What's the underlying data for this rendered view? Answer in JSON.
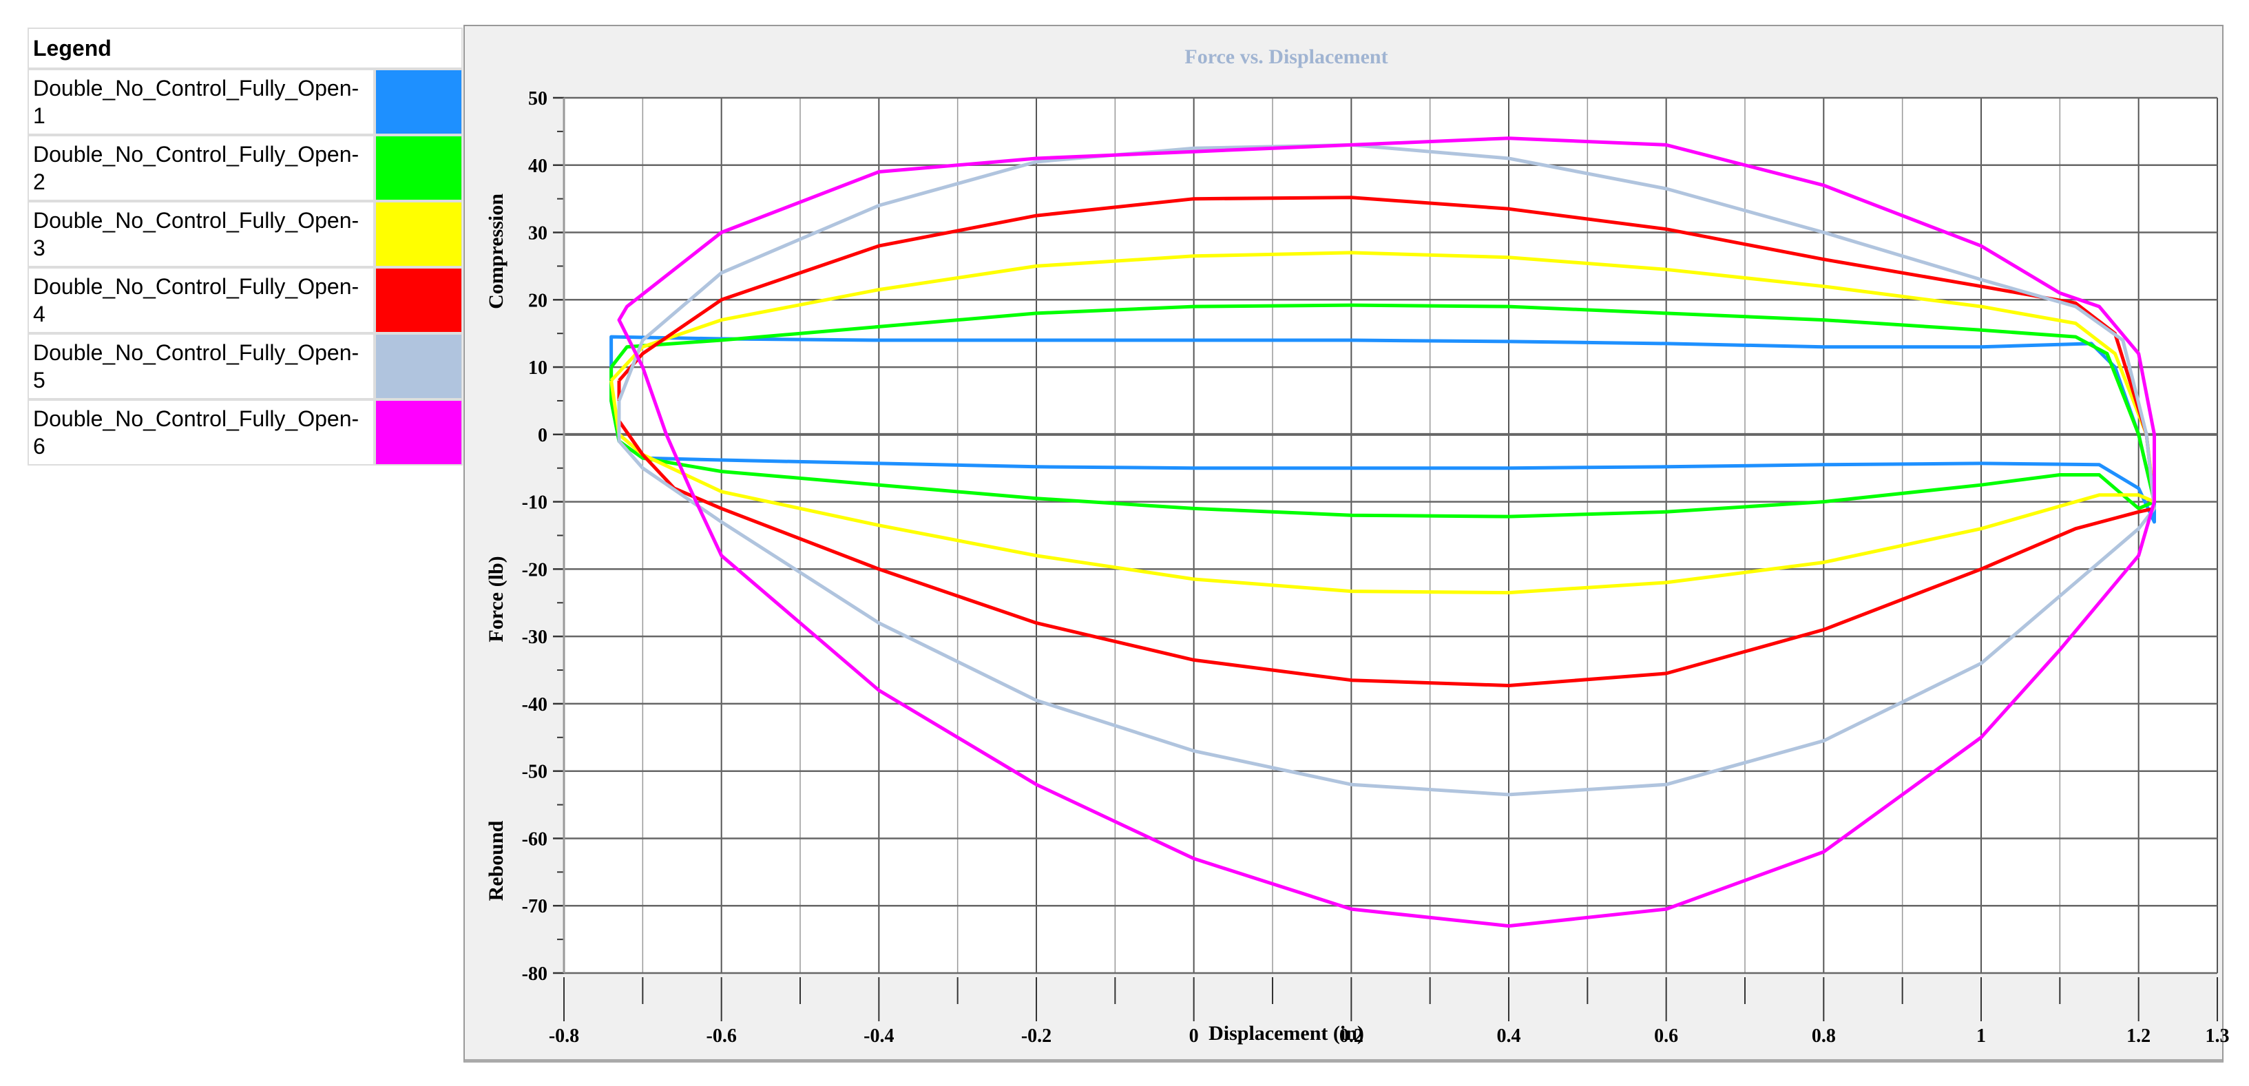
{
  "legend": {
    "title": "Legend",
    "items": [
      {
        "label": "Double_No_Control_Fully_Open-1",
        "color": "#1e90ff"
      },
      {
        "label": "Double_No_Control_Fully_Open-2",
        "color": "#00ff00"
      },
      {
        "label": "Double_No_Control_Fully_Open-3",
        "color": "#ffff00"
      },
      {
        "label": "Double_No_Control_Fully_Open-4",
        "color": "#ff0000"
      },
      {
        "label": "Double_No_Control_Fully_Open-5",
        "color": "#b0c4de"
      },
      {
        "label": "Double_No_Control_Fully_Open-6",
        "color": "#ff00ff"
      }
    ]
  },
  "chart_data": {
    "type": "line",
    "title": "Force vs. Displacement",
    "xlabel": "Displacement (in)",
    "ylabel": "Force (lb)",
    "ylabel_top": "Compression",
    "ylabel_bottom": "Rebound",
    "xlim": [
      -0.8,
      1.3
    ],
    "ylim": [
      -80,
      50
    ],
    "xticks": [
      -0.8,
      -0.6,
      -0.4,
      -0.2,
      0,
      0.2,
      0.4,
      0.6,
      0.8,
      1,
      1.2,
      1.3
    ],
    "yticks": [
      -80,
      -70,
      -60,
      -50,
      -40,
      -30,
      -20,
      -10,
      0,
      10,
      20,
      30,
      40,
      50
    ],
    "grid": true,
    "series": [
      {
        "name": "Double_No_Control_Fully_Open-1",
        "color": "#1e90ff",
        "points": [
          [
            -0.74,
            8
          ],
          [
            -0.74,
            14.5
          ],
          [
            -0.6,
            14.2
          ],
          [
            -0.4,
            14
          ],
          [
            -0.2,
            14
          ],
          [
            0,
            14
          ],
          [
            0.2,
            14
          ],
          [
            0.4,
            13.8
          ],
          [
            0.6,
            13.5
          ],
          [
            0.8,
            13
          ],
          [
            1.0,
            13
          ],
          [
            1.14,
            13.5
          ],
          [
            1.17,
            10
          ],
          [
            1.2,
            0
          ],
          [
            1.22,
            -10
          ],
          [
            1.22,
            -13
          ],
          [
            1.2,
            -8
          ],
          [
            1.15,
            -4.5
          ],
          [
            1.0,
            -4.3
          ],
          [
            0.8,
            -4.5
          ],
          [
            0.6,
            -4.8
          ],
          [
            0.4,
            -5
          ],
          [
            0.2,
            -5
          ],
          [
            0,
            -5
          ],
          [
            -0.2,
            -4.8
          ],
          [
            -0.4,
            -4.3
          ],
          [
            -0.6,
            -3.8
          ],
          [
            -0.7,
            -3.5
          ],
          [
            -0.73,
            -1
          ],
          [
            -0.74,
            5
          ],
          [
            -0.74,
            8
          ]
        ]
      },
      {
        "name": "Double_No_Control_Fully_Open-2",
        "color": "#00ff00",
        "points": [
          [
            -0.74,
            10
          ],
          [
            -0.72,
            13
          ],
          [
            -0.6,
            14
          ],
          [
            -0.4,
            16
          ],
          [
            -0.2,
            18
          ],
          [
            0,
            19
          ],
          [
            0.2,
            19.2
          ],
          [
            0.4,
            19
          ],
          [
            0.6,
            18
          ],
          [
            0.8,
            17
          ],
          [
            1.0,
            15.5
          ],
          [
            1.12,
            14.5
          ],
          [
            1.16,
            12
          ],
          [
            1.2,
            0
          ],
          [
            1.22,
            -10
          ],
          [
            1.2,
            -11
          ],
          [
            1.15,
            -6
          ],
          [
            1.1,
            -6
          ],
          [
            1.0,
            -7.5
          ],
          [
            0.8,
            -10
          ],
          [
            0.6,
            -11.5
          ],
          [
            0.4,
            -12.2
          ],
          [
            0.2,
            -12
          ],
          [
            0,
            -11
          ],
          [
            -0.2,
            -9.5
          ],
          [
            -0.4,
            -7.5
          ],
          [
            -0.6,
            -5.5
          ],
          [
            -0.7,
            -3.5
          ],
          [
            -0.73,
            -1
          ],
          [
            -0.74,
            5
          ],
          [
            -0.74,
            10
          ]
        ]
      },
      {
        "name": "Double_No_Control_Fully_Open-3",
        "color": "#ffff00",
        "points": [
          [
            -0.74,
            8
          ],
          [
            -0.7,
            13
          ],
          [
            -0.6,
            17
          ],
          [
            -0.4,
            21.5
          ],
          [
            -0.2,
            25
          ],
          [
            0,
            26.5
          ],
          [
            0.2,
            27
          ],
          [
            0.4,
            26.3
          ],
          [
            0.6,
            24.5
          ],
          [
            0.8,
            22
          ],
          [
            1.0,
            19
          ],
          [
            1.12,
            16.5
          ],
          [
            1.17,
            12
          ],
          [
            1.21,
            0
          ],
          [
            1.22,
            -10
          ],
          [
            1.2,
            -9
          ],
          [
            1.15,
            -9
          ],
          [
            1.0,
            -14
          ],
          [
            0.8,
            -19
          ],
          [
            0.6,
            -22
          ],
          [
            0.4,
            -23.5
          ],
          [
            0.2,
            -23.3
          ],
          [
            0,
            -21.5
          ],
          [
            -0.2,
            -18
          ],
          [
            -0.4,
            -13.5
          ],
          [
            -0.6,
            -8.5
          ],
          [
            -0.7,
            -3
          ],
          [
            -0.73,
            0
          ],
          [
            -0.74,
            8
          ]
        ]
      },
      {
        "name": "Double_No_Control_Fully_Open-4",
        "color": "#ff0000",
        "points": [
          [
            -0.73,
            8
          ],
          [
            -0.7,
            12
          ],
          [
            -0.6,
            20
          ],
          [
            -0.4,
            28
          ],
          [
            -0.2,
            32.5
          ],
          [
            0,
            35
          ],
          [
            0.2,
            35.2
          ],
          [
            0.4,
            33.5
          ],
          [
            0.6,
            30.5
          ],
          [
            0.8,
            26
          ],
          [
            1.0,
            22
          ],
          [
            1.12,
            19.5
          ],
          [
            1.17,
            15
          ],
          [
            1.21,
            0
          ],
          [
            1.22,
            -11
          ],
          [
            1.2,
            -11.5
          ],
          [
            1.12,
            -14
          ],
          [
            1.0,
            -20
          ],
          [
            0.8,
            -29
          ],
          [
            0.6,
            -35.5
          ],
          [
            0.4,
            -37.3
          ],
          [
            0.2,
            -36.5
          ],
          [
            0,
            -33.5
          ],
          [
            -0.2,
            -28
          ],
          [
            -0.4,
            -20
          ],
          [
            -0.6,
            -11
          ],
          [
            -0.66,
            -8
          ],
          [
            -0.7,
            -3
          ],
          [
            -0.73,
            2
          ],
          [
            -0.73,
            8
          ]
        ]
      },
      {
        "name": "Double_No_Control_Fully_Open-5",
        "color": "#b0c4de",
        "points": [
          [
            -0.73,
            5
          ],
          [
            -0.7,
            14
          ],
          [
            -0.6,
            24
          ],
          [
            -0.4,
            34
          ],
          [
            -0.2,
            40.5
          ],
          [
            0,
            42.5
          ],
          [
            0.2,
            43
          ],
          [
            0.4,
            41
          ],
          [
            0.6,
            36.5
          ],
          [
            0.8,
            30
          ],
          [
            1.0,
            23
          ],
          [
            1.12,
            19
          ],
          [
            1.18,
            14
          ],
          [
            1.21,
            0
          ],
          [
            1.22,
            -11
          ],
          [
            1.2,
            -14
          ],
          [
            1.1,
            -24
          ],
          [
            1.0,
            -34
          ],
          [
            0.8,
            -45.5
          ],
          [
            0.6,
            -52
          ],
          [
            0.4,
            -53.5
          ],
          [
            0.2,
            -52
          ],
          [
            0,
            -47
          ],
          [
            -0.2,
            -39.5
          ],
          [
            -0.4,
            -28
          ],
          [
            -0.6,
            -13
          ],
          [
            -0.7,
            -5
          ],
          [
            -0.73,
            -1
          ],
          [
            -0.73,
            5
          ]
        ]
      },
      {
        "name": "Double_No_Control_Fully_Open-6",
        "color": "#ff00ff",
        "points": [
          [
            -0.67,
            0
          ],
          [
            -0.7,
            10
          ],
          [
            -0.73,
            17
          ],
          [
            -0.72,
            19
          ],
          [
            -0.6,
            30
          ],
          [
            -0.4,
            39
          ],
          [
            -0.2,
            41
          ],
          [
            0,
            42
          ],
          [
            0.2,
            43
          ],
          [
            0.4,
            44
          ],
          [
            0.6,
            43
          ],
          [
            0.8,
            37
          ],
          [
            1.0,
            28
          ],
          [
            1.1,
            21
          ],
          [
            1.15,
            19
          ],
          [
            1.2,
            12
          ],
          [
            1.22,
            0
          ],
          [
            1.22,
            -10
          ],
          [
            1.2,
            -18
          ],
          [
            1.1,
            -32
          ],
          [
            1.0,
            -45
          ],
          [
            0.8,
            -62
          ],
          [
            0.6,
            -70.5
          ],
          [
            0.4,
            -73
          ],
          [
            0.2,
            -70.5
          ],
          [
            0,
            -63
          ],
          [
            -0.2,
            -52
          ],
          [
            -0.4,
            -38
          ],
          [
            -0.6,
            -18
          ],
          [
            -0.64,
            -8
          ],
          [
            -0.67,
            0
          ]
        ]
      }
    ]
  }
}
